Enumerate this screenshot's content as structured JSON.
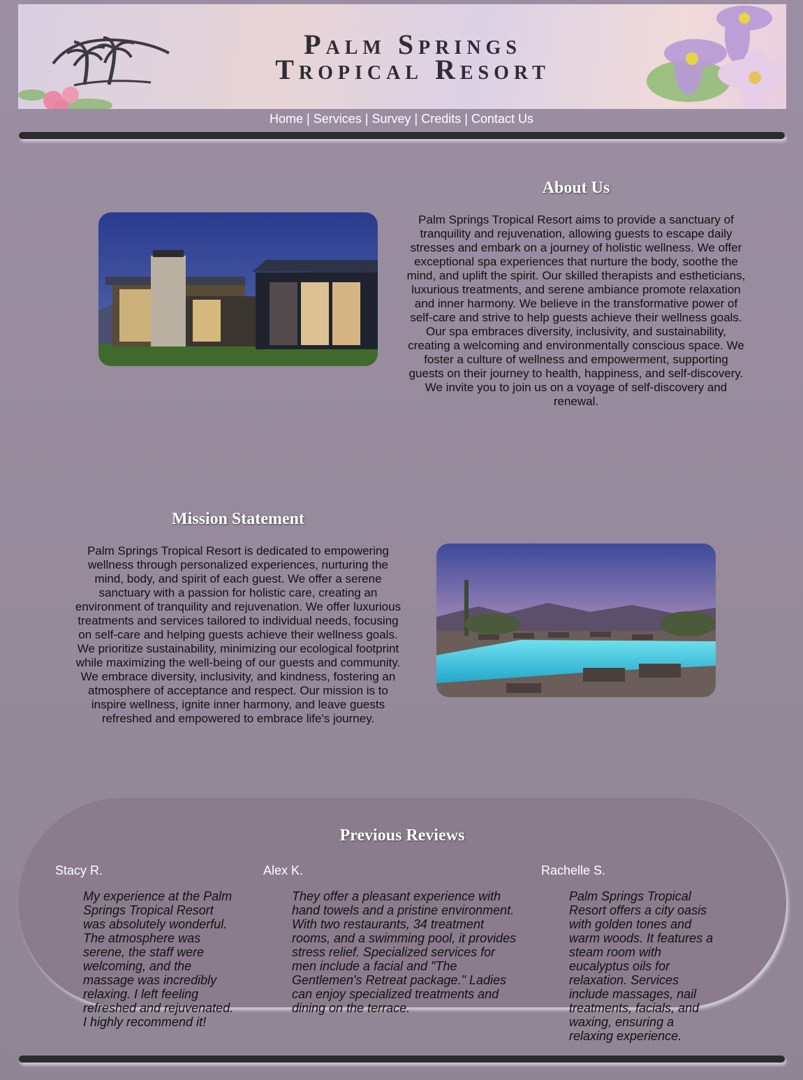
{
  "header": {
    "title_line1": "Palm Springs",
    "title_line2": "Tropical Resort"
  },
  "nav": {
    "items": [
      "Home",
      "Services",
      "Survey",
      "Credits",
      "Contact Us"
    ],
    "separator": "|"
  },
  "about": {
    "heading": "About Us",
    "text": "Palm Springs Tropical Resort aims to provide a sanctuary of tranquility and rejuvenation, allowing guests to escape daily stresses and embark on a journey of holistic wellness. We offer exceptional spa experiences that nurture the body, soothe the mind, and uplift the spirit. Our skilled therapists and estheticians, luxurious treatments, and serene ambiance promote relaxation and inner harmony. We believe in the transformative power of self-care and strive to help guests achieve their wellness goals. Our spa embraces diversity, inclusivity, and sustainability, creating a welcoming and environmentally conscious space. We foster a culture of wellness and empowerment, supporting guests on their journey to health, happiness, and self-discovery. We invite you to join us on a voyage of self-discovery and renewal."
  },
  "mission": {
    "heading": "Mission Statement",
    "text": "Palm Springs Tropical Resort is dedicated to empowering wellness through personalized experiences, nurturing the mind, body, and spirit of each guest. We offer a serene sanctuary with a passion for holistic care, creating an environment of tranquility and rejuvenation. We offer luxurious treatments and services tailored to individual needs, focusing on self-care and helping guests achieve their wellness goals. We prioritize sustainability, minimizing our ecological footprint while maximizing the well-being of our guests and community. We embrace diversity, inclusivity, and kindness, fostering an atmosphere of acceptance and respect. Our mission is to inspire wellness, ignite inner harmony, and leave guests refreshed and empowered to embrace life's journey."
  },
  "reviews": {
    "heading": "Previous Reviews",
    "items": [
      {
        "name": "Stacy R.",
        "text": "My experience at the Palm Springs Tropical Resort was absolutely wonderful. The atmosphere was serene, the staff were welcoming, and the massage was incredibly relaxing. I left feeling refreshed and rejuvenated. I highly recommend it!"
      },
      {
        "name": "Alex K.",
        "text": "They offer a pleasant experience with hand towels and a pristine environment. With two restaurants, 34 treatment rooms, and a swimming pool, it provides stress relief. Specialized services for men include a facial and \"The Gentlemen's Retreat package.\" Ladies can enjoy specialized treatments and dining on the terrace."
      },
      {
        "name": "Rachelle S.",
        "text": "Palm Springs Tropical Resort offers a city oasis with golden tones and warm woods. It features a steam room with eucalyptus oils for relaxation. Services include massages, nail treatments, facials, and waxing, ensuring a relaxing experience."
      }
    ]
  },
  "colors": {
    "page_bg": "#9b8ea3",
    "rule": "#2c2b2e",
    "reviews_bg": "#8a7c8c",
    "heading": "#ffffff"
  }
}
